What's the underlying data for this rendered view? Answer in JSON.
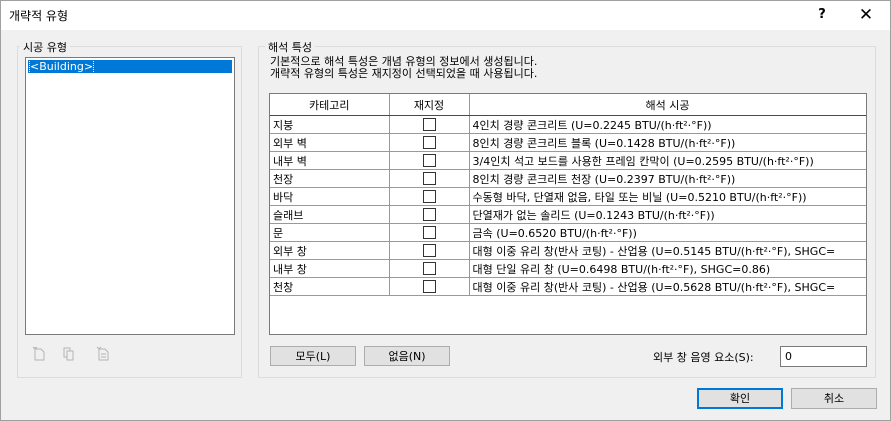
{
  "window": {
    "title": "개략적 유형",
    "help_label": "?",
    "close_label": "✕"
  },
  "construction_types": {
    "label": "시공 유형",
    "items": [
      "<Building>"
    ],
    "icons": [
      "new-type-icon",
      "duplicate-icon",
      "rename-icon"
    ]
  },
  "analytic_properties": {
    "label": "해석 특성",
    "description_line1": "기본적으로 해석 특성은 개념 유형의 정보에서 생성됩니다.",
    "description_line2": "개략적 유형의 특성은 재지정이 선택되었을 때 사용됩니다.",
    "columns": [
      "카테고리",
      "재지정",
      "해석 시공"
    ],
    "rows": [
      {
        "category": "지붕",
        "override": false,
        "construction": "4인치 경량 콘크리트 (U=0.2245 BTU/(h·ft²·°F))"
      },
      {
        "category": "외부 벽",
        "override": false,
        "construction": "8인치 경량 콘크리트 블록 (U=0.1428 BTU/(h·ft²·°F))"
      },
      {
        "category": "내부 벽",
        "override": false,
        "construction": "3/4인치 석고 보드를 사용한 프레임 칸막이 (U=0.2595 BTU/(h·ft²·°F))"
      },
      {
        "category": "천장",
        "override": false,
        "construction": "8인치 경량 콘크리트 천장 (U=0.2397 BTU/(h·ft²·°F))"
      },
      {
        "category": "바닥",
        "override": false,
        "construction": "수동형 바닥, 단열재 없음, 타일 또는 비닐 (U=0.5210 BTU/(h·ft²·°F))"
      },
      {
        "category": "슬래브",
        "override": false,
        "construction": "단열재가 없는 솔리드 (U=0.1243 BTU/(h·ft²·°F))"
      },
      {
        "category": "문",
        "override": false,
        "construction": "금속 (U=0.6520 BTU/(h·ft²·°F))"
      },
      {
        "category": "외부 창",
        "override": false,
        "construction": "대형 이중 유리 창(반사 코팅) - 산업용 (U=0.5145 BTU/(h·ft²·°F), SHGC="
      },
      {
        "category": "내부 창",
        "override": false,
        "construction": "대형 단일 유리 창 (U=0.6498 BTU/(h·ft²·°F), SHGC=0.86)"
      },
      {
        "category": "천창",
        "override": false,
        "construction": "대형 이중 유리 창(반사 코팅) - 산업용 (U=0.5628 BTU/(h·ft²·°F), SHGC="
      }
    ],
    "all_button": "모두(L)",
    "none_button": "없음(N)",
    "shading_factor_label": "외부 창 음영 요소(S):",
    "shading_factor_value": "0"
  },
  "footer": {
    "ok_button": "확인",
    "cancel_button": "취소"
  },
  "colors": {
    "selection": "#0078d7",
    "background": "#f0f0f0"
  }
}
